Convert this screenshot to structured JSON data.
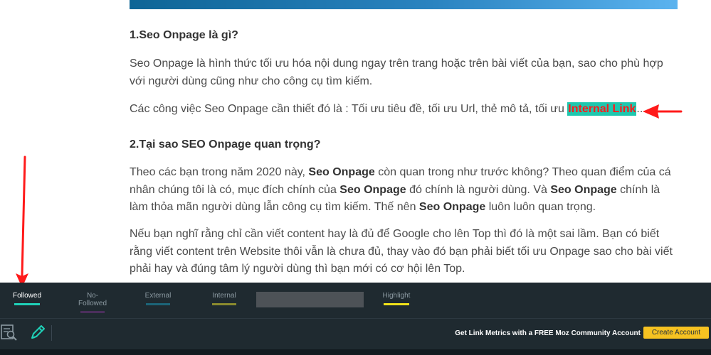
{
  "article": {
    "heading1": "1.Seo Onpage là gì?",
    "para1": "Seo Onpage là hình thức tối ưu hóa nội dung ngay trên trang hoặc trên bài viết của bạn, sao cho phù hợp với người dùng cũng như cho công cụ tìm kiếm.",
    "para2_prefix": "Các công việc Seo Onpage cần thiết đó là : Tối ưu tiêu đề, tối ưu Url, thẻ mô tả, tối ưu ",
    "para2_link": "Internal Link",
    "para2_suffix": "...",
    "heading2": "2.Tại sao SEO Onpage quan trọng?",
    "para3_a": "Theo các bạn trong năm 2020 này, ",
    "para3_b": "Seo Onpage",
    "para3_c": " còn quan trong như trước không? Theo quan điểm của cá nhân chúng tôi là có, mục đích chính của ",
    "para3_d": "Seo Onpage",
    "para3_e": " đó chính là người dùng. Và ",
    "para3_f": "Seo Onpage",
    "para3_g": " chính là làm thỏa mãn người dùng lẫn công cụ tìm kiếm. Thế nên ",
    "para3_h": "Seo Onpage",
    "para3_i": " luôn luôn quan trọng.",
    "para4": "Nếu bạn nghĩ rằng chỉ cần viết content hay là đủ để Google cho lên Top thì đó là một sai lầm. Bạn có biết rằng viết content trên Website thôi vẫn là chưa đủ, thay vào đó bạn phải biết tối ưu Onpage sao cho bài viết phải hay và đúng tâm lý người dùng thì bạn mới có cơ hội lên Top."
  },
  "mozbar": {
    "legend": [
      {
        "label": "Followed",
        "color": "#1fd1b8",
        "active": true
      },
      {
        "label": "No-Followed",
        "color": "#4b2f5c",
        "active": false
      },
      {
        "label": "External",
        "color": "#1c6478",
        "active": false
      },
      {
        "label": "Internal",
        "color": "#8b8b2e",
        "active": false
      },
      {
        "label": "Highlight",
        "color": "#f0e21a",
        "active": false
      }
    ],
    "cta_text": "Get Link Metrics with a FREE Moz Community Account",
    "cta_button": "Create Account",
    "icons": [
      "page-analysis-icon",
      "highlight-pencil-icon"
    ]
  },
  "colors": {
    "annotation_arrow": "#ff1a1a",
    "mozbar_bg": "#1f2a30",
    "cta_button_bg": "#f6c221",
    "link_highlight_bg": "#1fc7ae"
  }
}
